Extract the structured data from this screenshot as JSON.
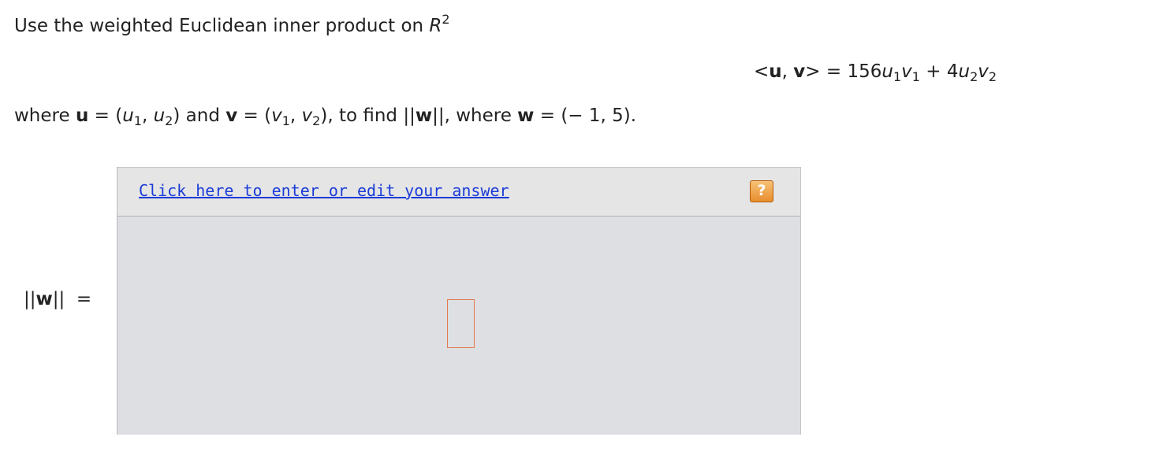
{
  "problem": {
    "intro": "Use the weighted Euclidean inner product on ",
    "space_base": "R",
    "space_exp": "2",
    "formula": {
      "lhs_open": "<",
      "u": "u",
      "comma": ", ",
      "v": "v",
      "lhs_close": ">",
      "equals": " = ",
      "coef1": "156",
      "u1": "u",
      "sub_1a": "1",
      "v1": "v",
      "sub_1b": "1",
      "plus": " + ",
      "coef2": "4",
      "u2": "u",
      "sub_2a": "2",
      "v2": "v",
      "sub_2b": "2"
    },
    "where_line": {
      "where1": "where ",
      "u_bold": "u",
      "eq1": " = (",
      "u1": "u",
      "s1": "1",
      "comma1": ", ",
      "u2": "u",
      "s2": "2",
      "close1": ") and ",
      "v_bold": "v",
      "eq2": " = (",
      "v1": "v",
      "s3": "1",
      "comma2": ", ",
      "v2": "v",
      "s4": "2",
      "close2": "), to find ||",
      "w_bold1": "w",
      "close3": "||, where ",
      "w_bold2": "w",
      "eq3": " = (− 1, 5)."
    }
  },
  "answer": {
    "edit_link": "Click here to enter or edit your answer",
    "help_label": "?",
    "norm_open": "||",
    "norm_w": "w",
    "norm_close": "||",
    "norm_equals": "  =",
    "value": ""
  }
}
